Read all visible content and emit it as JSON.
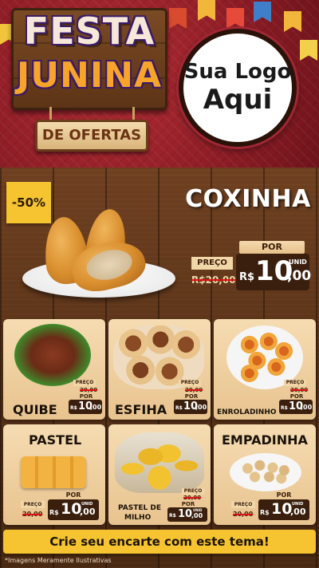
{
  "header": {
    "title_line1": "FESTA",
    "title_line2": "JUNINA",
    "subtitle": "DE OFERTAS",
    "logo_line1": "Sua Logo",
    "logo_line2": "Aqui"
  },
  "featured": {
    "discount_badge": "-50%",
    "name": "COXINHA",
    "preco_label": "PREÇO",
    "old_price": "R$20,00",
    "por_label": "POR",
    "currency": "R$",
    "price_int": "10",
    "price_cents": ",00",
    "unit_label": "UNID"
  },
  "products": [
    {
      "name": "QUIBE",
      "preco_label": "PREÇO",
      "old_price": "20,00",
      "por_label": "POR",
      "currency": "R$",
      "price_int": "10",
      "price_cents": ",00"
    },
    {
      "name": "ESFIHA",
      "preco_label": "PREÇO",
      "old_price": "20,00",
      "por_label": "POR",
      "currency": "R$",
      "price_int": "10",
      "price_cents": ",00"
    },
    {
      "name": "ENROLADINHO",
      "preco_label": "PREÇO",
      "old_price": "20,00",
      "por_label": "POR",
      "currency": "R$",
      "price_int": "10",
      "price_cents": ",00"
    },
    {
      "name": "PASTEL",
      "preco_label": "PREÇO",
      "old_price": "20,00",
      "por_label": "POR",
      "currency": "R$",
      "price_int": "10",
      "price_cents": ",00",
      "unit_label": "UNID"
    },
    {
      "name_line1": "PASTEL DE",
      "name_line2": "MILHO",
      "preco_label": "PREÇO",
      "old_price": "20,00",
      "por_label": "POR",
      "currency": "R$",
      "price_int": "10",
      "price_cents": ",00",
      "unit_label": "UNID"
    },
    {
      "name": "EMPADINHA",
      "preco_label": "PREÇO",
      "old_price": "20,00",
      "por_label": "POR",
      "currency": "R$",
      "price_int": "10",
      "price_cents": ",00",
      "unit_label": "UNID"
    }
  ],
  "cta": {
    "label": "Crie seu encarte com este tema!"
  },
  "footnote": "*Imagens Meramente Ilustrativas",
  "colors": {
    "header_red": "#8e1d26",
    "wood_brown": "#5a3318",
    "badge_yellow": "#f5c430",
    "price_dark": "#3a1f0e",
    "tag_cream": "#f1d6a8",
    "strike_red": "#dd1111"
  }
}
